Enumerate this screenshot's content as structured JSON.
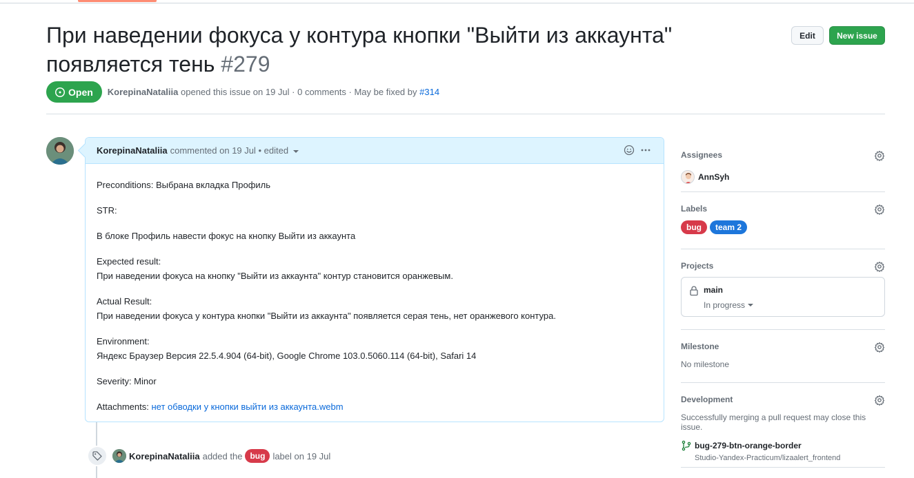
{
  "issue": {
    "title": "При наведении фокуса у контура кнопки \"Выйти из аккаунта\" появляется тень",
    "number": "#279",
    "state": "Open",
    "author": "KorepinaNataliia",
    "opened_text": "opened this issue on 19 Jul · 0 comments · May be fixed by",
    "fixed_by": "#314"
  },
  "header_buttons": {
    "edit": "Edit",
    "new_issue": "New issue"
  },
  "comment": {
    "author": "KorepinaNataliia",
    "meta": "commented on 19 Jul • edited",
    "body": {
      "preconditions": "Preconditions: Выбрана вкладка Профиль",
      "str": "STR:",
      "step": "В блоке Профиль навести фокус на кнопку Выйти из аккаунта",
      "expected_label": "Expected result:",
      "expected_text": "При наведении фокуса на кнопку \"Выйти из аккаунта\" контур становится оранжевым.",
      "actual_label": "Actual Result:",
      "actual_text": "При наведении фокуса у контура кнопки \"Выйти из аккаунта\" появляется серая тень, нет оранжевого контура.",
      "env_label": "Environment:",
      "env_text": "Яндекс Браузер Версия 22.5.4.904 (64-bit), Google Chrome 103.0.5060.114 (64-bit), Safari 14",
      "severity": "Severity: Minor",
      "attachments_label": "Attachments:",
      "attachment_link": "нет обводки у кнопки выйти из аккаунта.webm"
    }
  },
  "event": {
    "author": "KorepinaNataliia",
    "action": "added the",
    "label": "bug",
    "suffix": "label on 19 Jul"
  },
  "sidebar": {
    "assignees": {
      "title": "Assignees",
      "user": "AnnSyh"
    },
    "labels": {
      "title": "Labels",
      "items": [
        {
          "name": "bug",
          "color": "#d73a4a"
        },
        {
          "name": "team 2",
          "color": "#1d76db"
        }
      ]
    },
    "projects": {
      "title": "Projects",
      "name": "main",
      "status": "In progress"
    },
    "milestone": {
      "title": "Milestone",
      "value": "No milestone"
    },
    "development": {
      "title": "Development",
      "description": "Successfully merging a pull request may close this issue.",
      "branch": "bug-279-btn-orange-border",
      "repo": "Studio-Yandex-Practicum/lizaalert_frontend"
    }
  },
  "colors": {
    "open_green": "#2da44e",
    "link_blue": "#0969da",
    "comment_header_bg": "#ddf4ff",
    "comment_border": "#b6e3ff"
  }
}
